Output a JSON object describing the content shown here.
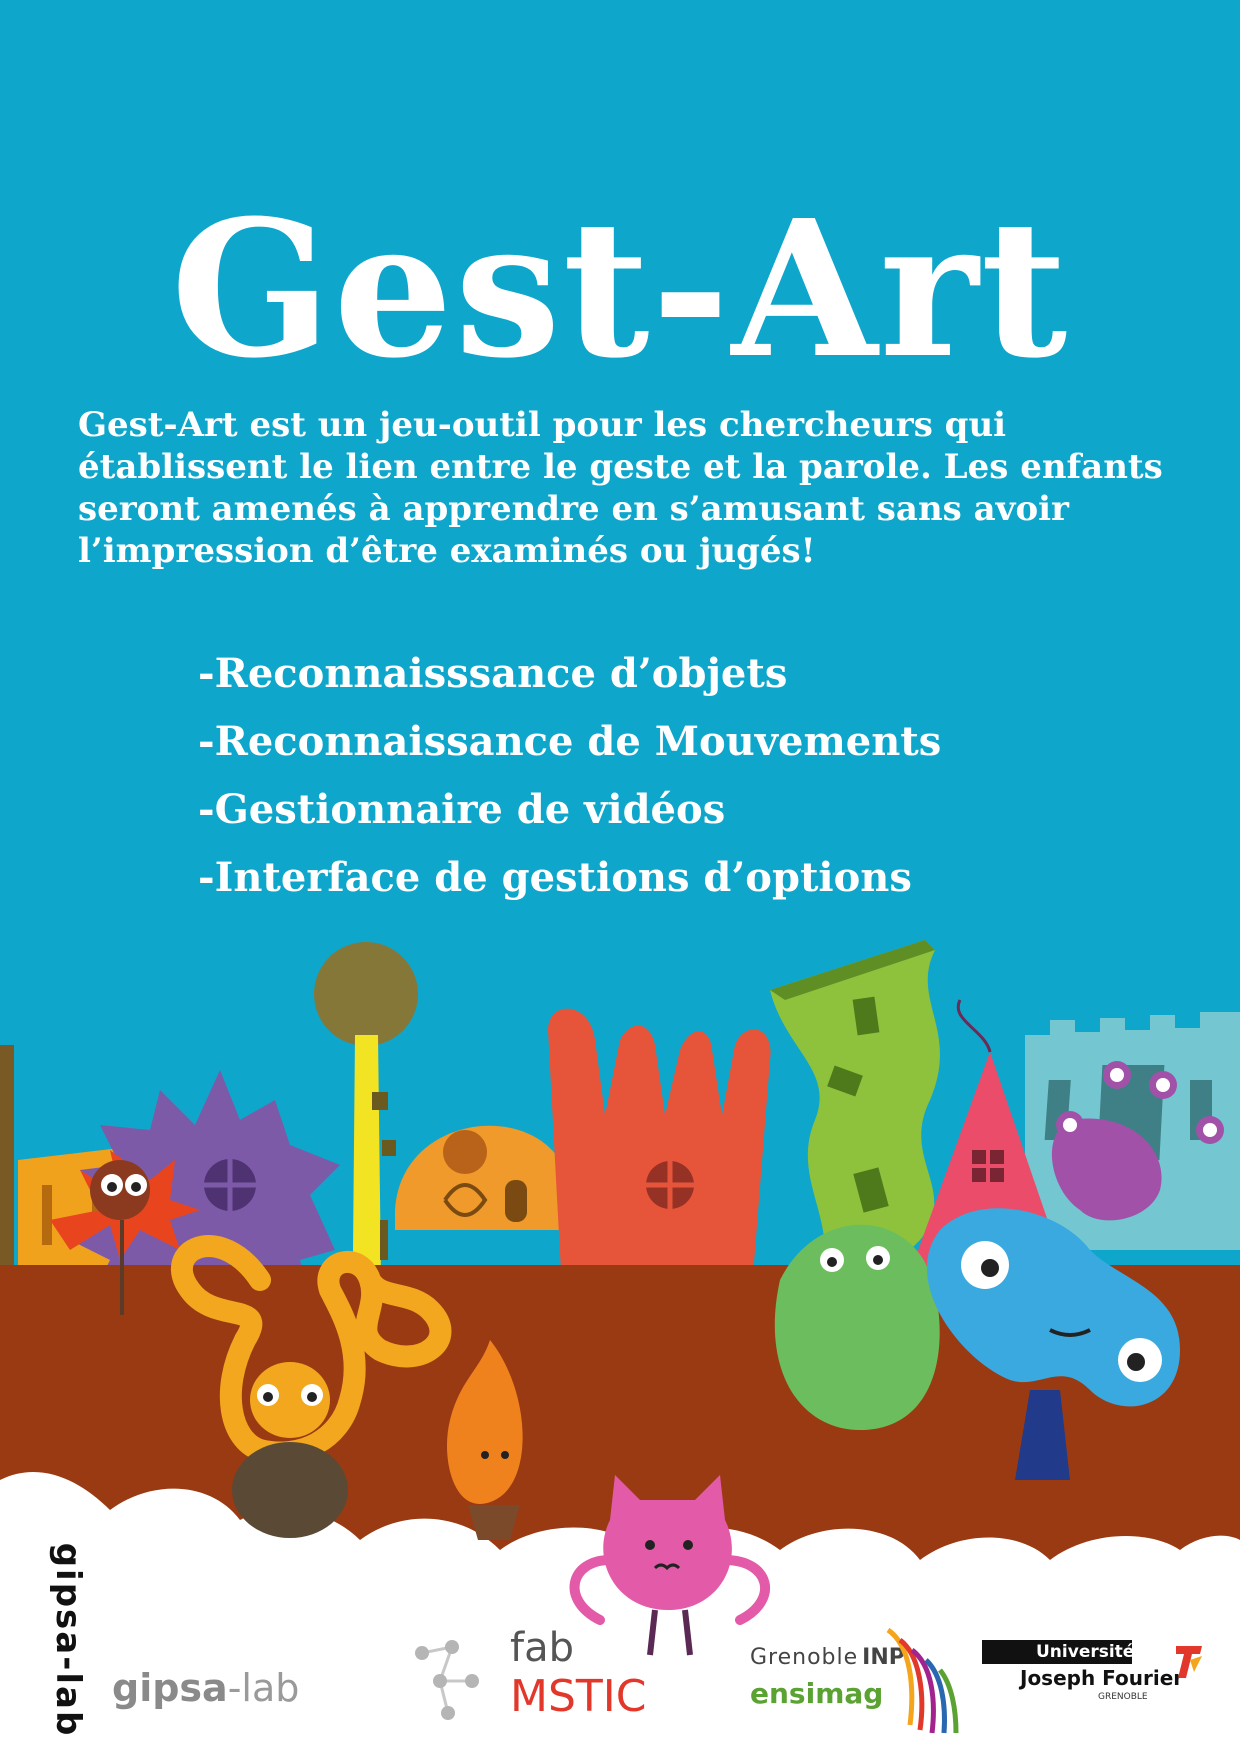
{
  "poster": {
    "title": "Gest-Art",
    "description": "Gest-Art est un jeu-outil pour les chercheurs qui établissent le lien entre le geste et la parole. Les enfants seront amenés à apprendre en s’amusant sans avoir l’impression d’être examinés ou jugés!",
    "features": [
      "-Reconnaisssance d’objets",
      "-Reconnaissance de Mouvements",
      "-Gestionnaire de vidéos",
      "-Interface de gestions d’options"
    ]
  },
  "logos": {
    "gipsa": {
      "name_a": "gipsa",
      "name_b": "-lab",
      "vertical": "gipsa-lab"
    },
    "fabmstic": {
      "line1": "fab",
      "line2": "MSTIC"
    },
    "grenoble_inp": {
      "line1a": "Grenoble",
      "line1b": "INP",
      "line2": "ensimag"
    },
    "ujf": {
      "line1": "Université",
      "line2": "Joseph Fourier",
      "line3": "GRENOBLE"
    }
  },
  "colors": {
    "background": "#0fa6cb",
    "ground": "#9a3a12",
    "text": "#ffffff",
    "msticRed": "#e2382b",
    "inpGreen": "#5aa231"
  }
}
